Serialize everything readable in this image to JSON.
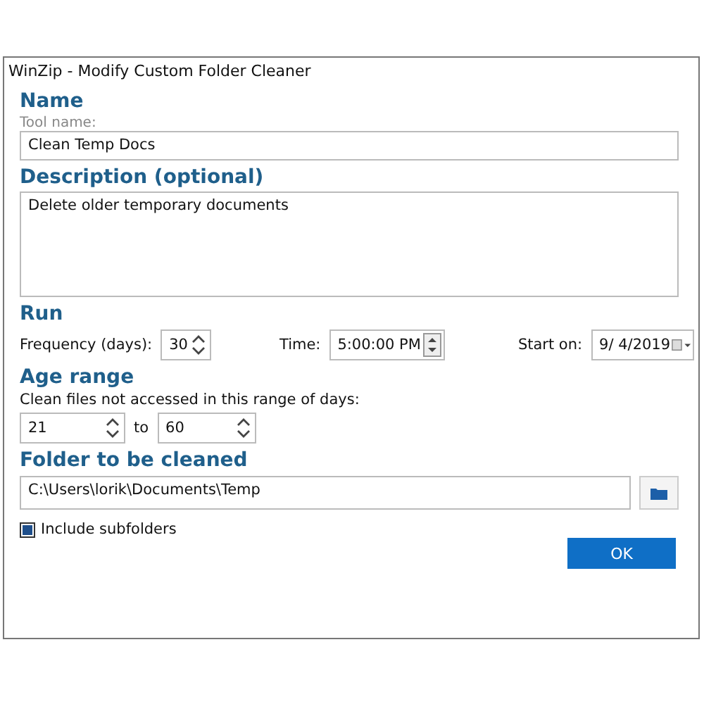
{
  "window": {
    "title": "WinZip - Modify Custom Folder Cleaner"
  },
  "name_section": {
    "heading": "Name",
    "label": "Tool name:",
    "value": "Clean Temp Docs"
  },
  "description_section": {
    "heading": "Description (optional)",
    "value": "Delete older temporary documents"
  },
  "run_section": {
    "heading": "Run",
    "frequency_label": "Frequency (days):",
    "frequency": "30",
    "time_label": "Time:",
    "time": "5:00:00 PM",
    "start_label": "Start on:",
    "start_date": "9/  4/2019"
  },
  "age_section": {
    "heading": "Age range",
    "label": "Clean files not accessed in this range of days:",
    "from": "21",
    "to_label": "to",
    "to": "60"
  },
  "folder_section": {
    "heading": "Folder to be cleaned",
    "path": "C:\\Users\\lorik\\Documents\\Temp"
  },
  "include_subfolders": {
    "label": "Include subfolders",
    "checked": true
  },
  "buttons": [
    "OK"
  ]
}
